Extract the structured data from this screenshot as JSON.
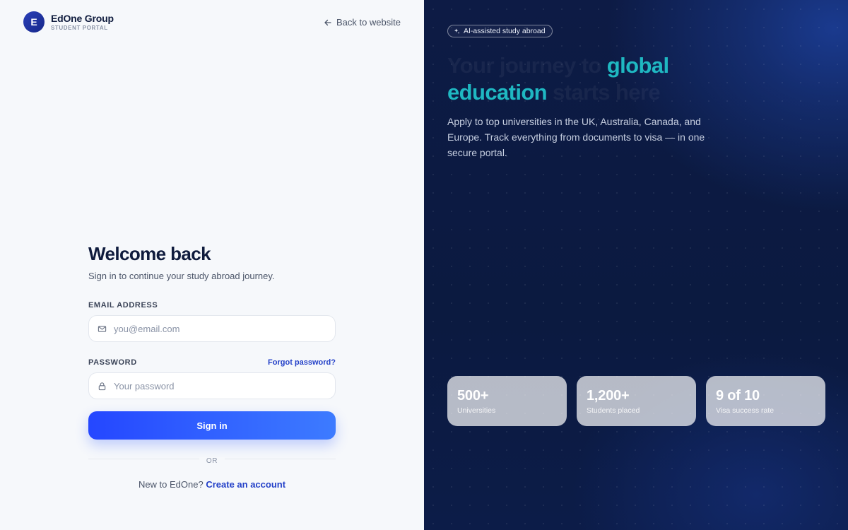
{
  "brand": {
    "logo_letter": "E",
    "name": "EdOne Group",
    "subtitle": "STUDENT PORTAL"
  },
  "header": {
    "back_label": "Back to website"
  },
  "form": {
    "title": "Welcome back",
    "subtitle": "Sign in to continue your study abroad journey.",
    "email_label": "EMAIL ADDRESS",
    "email_placeholder": "you@email.com",
    "password_label": "PASSWORD",
    "forgot_label": "Forgot password?",
    "password_placeholder": "Your password",
    "submit_label": "Sign in",
    "divider_label": "OR",
    "signup_prompt": "New to EdOne?",
    "signup_link": "Create an account"
  },
  "hero": {
    "badge": "AI-assisted study abroad",
    "headline_part1": "Your journey to ",
    "headline_accent": "global education",
    "headline_part2": " starts here",
    "description": "Apply to top universities in the UK, Australia, Canada, and Europe. Track everything from documents to visa — in one secure portal.",
    "stats": [
      {
        "value": "500+",
        "label": "Universities"
      },
      {
        "value": "1,200+",
        "label": "Students placed"
      },
      {
        "value": "9 of 10",
        "label": "Visa success rate"
      }
    ]
  },
  "colors": {
    "primary": "#2547ff",
    "accent": "#1fb8c2",
    "dark_panel": "#0d1b45",
    "link": "#2340c8"
  },
  "icons": {
    "back": "arrow-left-icon",
    "email": "mail-icon",
    "password": "lock-icon",
    "badge": "sparkle-icon"
  }
}
